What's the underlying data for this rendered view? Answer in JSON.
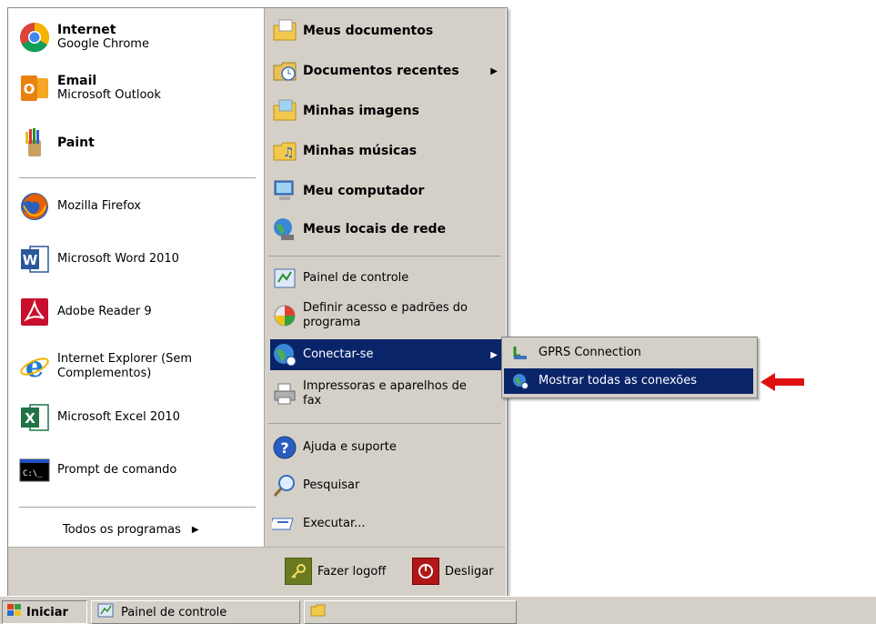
{
  "start_menu": {
    "pinned": [
      {
        "title": "Internet",
        "subtitle": "Google Chrome"
      },
      {
        "title": "Email",
        "subtitle": "Microsoft Outlook"
      },
      {
        "title": "Paint",
        "subtitle": ""
      }
    ],
    "recent": [
      {
        "label": "Mozilla Firefox"
      },
      {
        "label": "Microsoft Word 2010"
      },
      {
        "label": "Adobe Reader 9"
      },
      {
        "label": "Internet Explorer (Sem Complementos)"
      },
      {
        "label": "Microsoft Excel 2010"
      },
      {
        "label": "Prompt de comando"
      }
    ],
    "all_programs": "Todos os programas",
    "places": [
      {
        "label": "Meus documentos"
      },
      {
        "label": "Documentos recentes"
      },
      {
        "label": "Minhas imagens"
      },
      {
        "label": "Minhas músicas"
      },
      {
        "label": "Meu computador"
      },
      {
        "label": "Meus locais de rede"
      }
    ],
    "system": [
      {
        "label": "Painel de controle"
      },
      {
        "label": "Definir acesso e padrões do programa"
      },
      {
        "label": "Conectar-se"
      },
      {
        "label": "Impressoras e aparelhos de fax"
      }
    ],
    "help": [
      {
        "label": "Ajuda e suporte"
      },
      {
        "label": "Pesquisar"
      },
      {
        "label": "Executar..."
      }
    ],
    "logoff": "Fazer logoff",
    "shutdown": "Desligar"
  },
  "submenu": {
    "items": [
      {
        "label": "GPRS Connection"
      },
      {
        "label": "Mostrar todas as conexões"
      }
    ]
  },
  "taskbar": {
    "start_label": "Iniciar",
    "window_label": "Painel de controle"
  },
  "colors": {
    "selection": "#0a246a",
    "arrow": "#e01010"
  }
}
